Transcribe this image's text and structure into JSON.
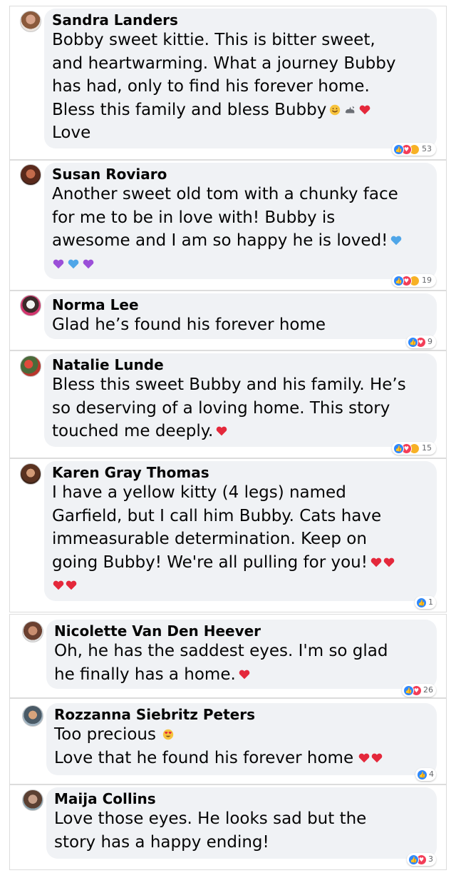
{
  "comments": [
    {
      "name": "Sandra Landers",
      "lines": [
        "Bobby sweet kittie. This is bitter sweet,",
        "and heartwarming. What a journey Bubby",
        "has had, only to find his forever home.",
        "Bless this family and bless Bubby",
        "Love"
      ],
      "reaction_count": "53"
    },
    {
      "name": "Susan Roviaro",
      "lines": [
        "Another sweet old tom with a chunky face",
        "for me to be in love with! Bubby is",
        "awesome and I am so happy he is loved!",
        ""
      ],
      "reaction_count": "19"
    },
    {
      "name": "Norma Lee",
      "lines": [
        "Glad he’s found his forever home"
      ],
      "reaction_count": "9"
    },
    {
      "name": "Natalie Lunde",
      "lines": [
        "Bless this sweet Bubby and his family. He’s",
        "so deserving of a loving home. This story",
        "touched me deeply."
      ],
      "reaction_count": "15"
    },
    {
      "name": "Karen Gray Thomas",
      "lines": [
        "I have a yellow kitty (4 legs) named",
        "Garfield, but I call him Bubby. Cats have",
        "immeasurable determination. Keep on",
        "going Bubby! We're all pulling for you!",
        ""
      ],
      "reaction_count": "1"
    },
    {
      "name": "Nicolette Van Den Heever",
      "lines": [
        "Oh, he has the saddest eyes. I'm so glad",
        "he finally has a home."
      ],
      "reaction_count": "26"
    },
    {
      "name": "Rozzanna Siebritz Peters",
      "lines": [
        "Too precious",
        "Love that he found his forever home"
      ],
      "reaction_count": "4"
    },
    {
      "name": "Maija Collins",
      "lines": [
        "Love those eyes. He looks sad but the",
        "story has a happy ending!"
      ],
      "reaction_count": "3"
    }
  ],
  "colors": {
    "bubble": "#f0f2f5",
    "like": "#2d88ff",
    "love": "#f33e58",
    "care": "#f7b125",
    "heart": "#e4283b",
    "purple_heart": "#9b4fd8",
    "blue_heart": "#4fa6e8"
  },
  "icons": [
    "avatar",
    "smile-emoji-icon",
    "cat-emoji-icon",
    "red-heart-icon",
    "blue-heart-icon",
    "purple-heart-icon",
    "heart-eyes-emoji-icon",
    "like-reaction-icon",
    "love-reaction-icon",
    "care-reaction-icon"
  ]
}
